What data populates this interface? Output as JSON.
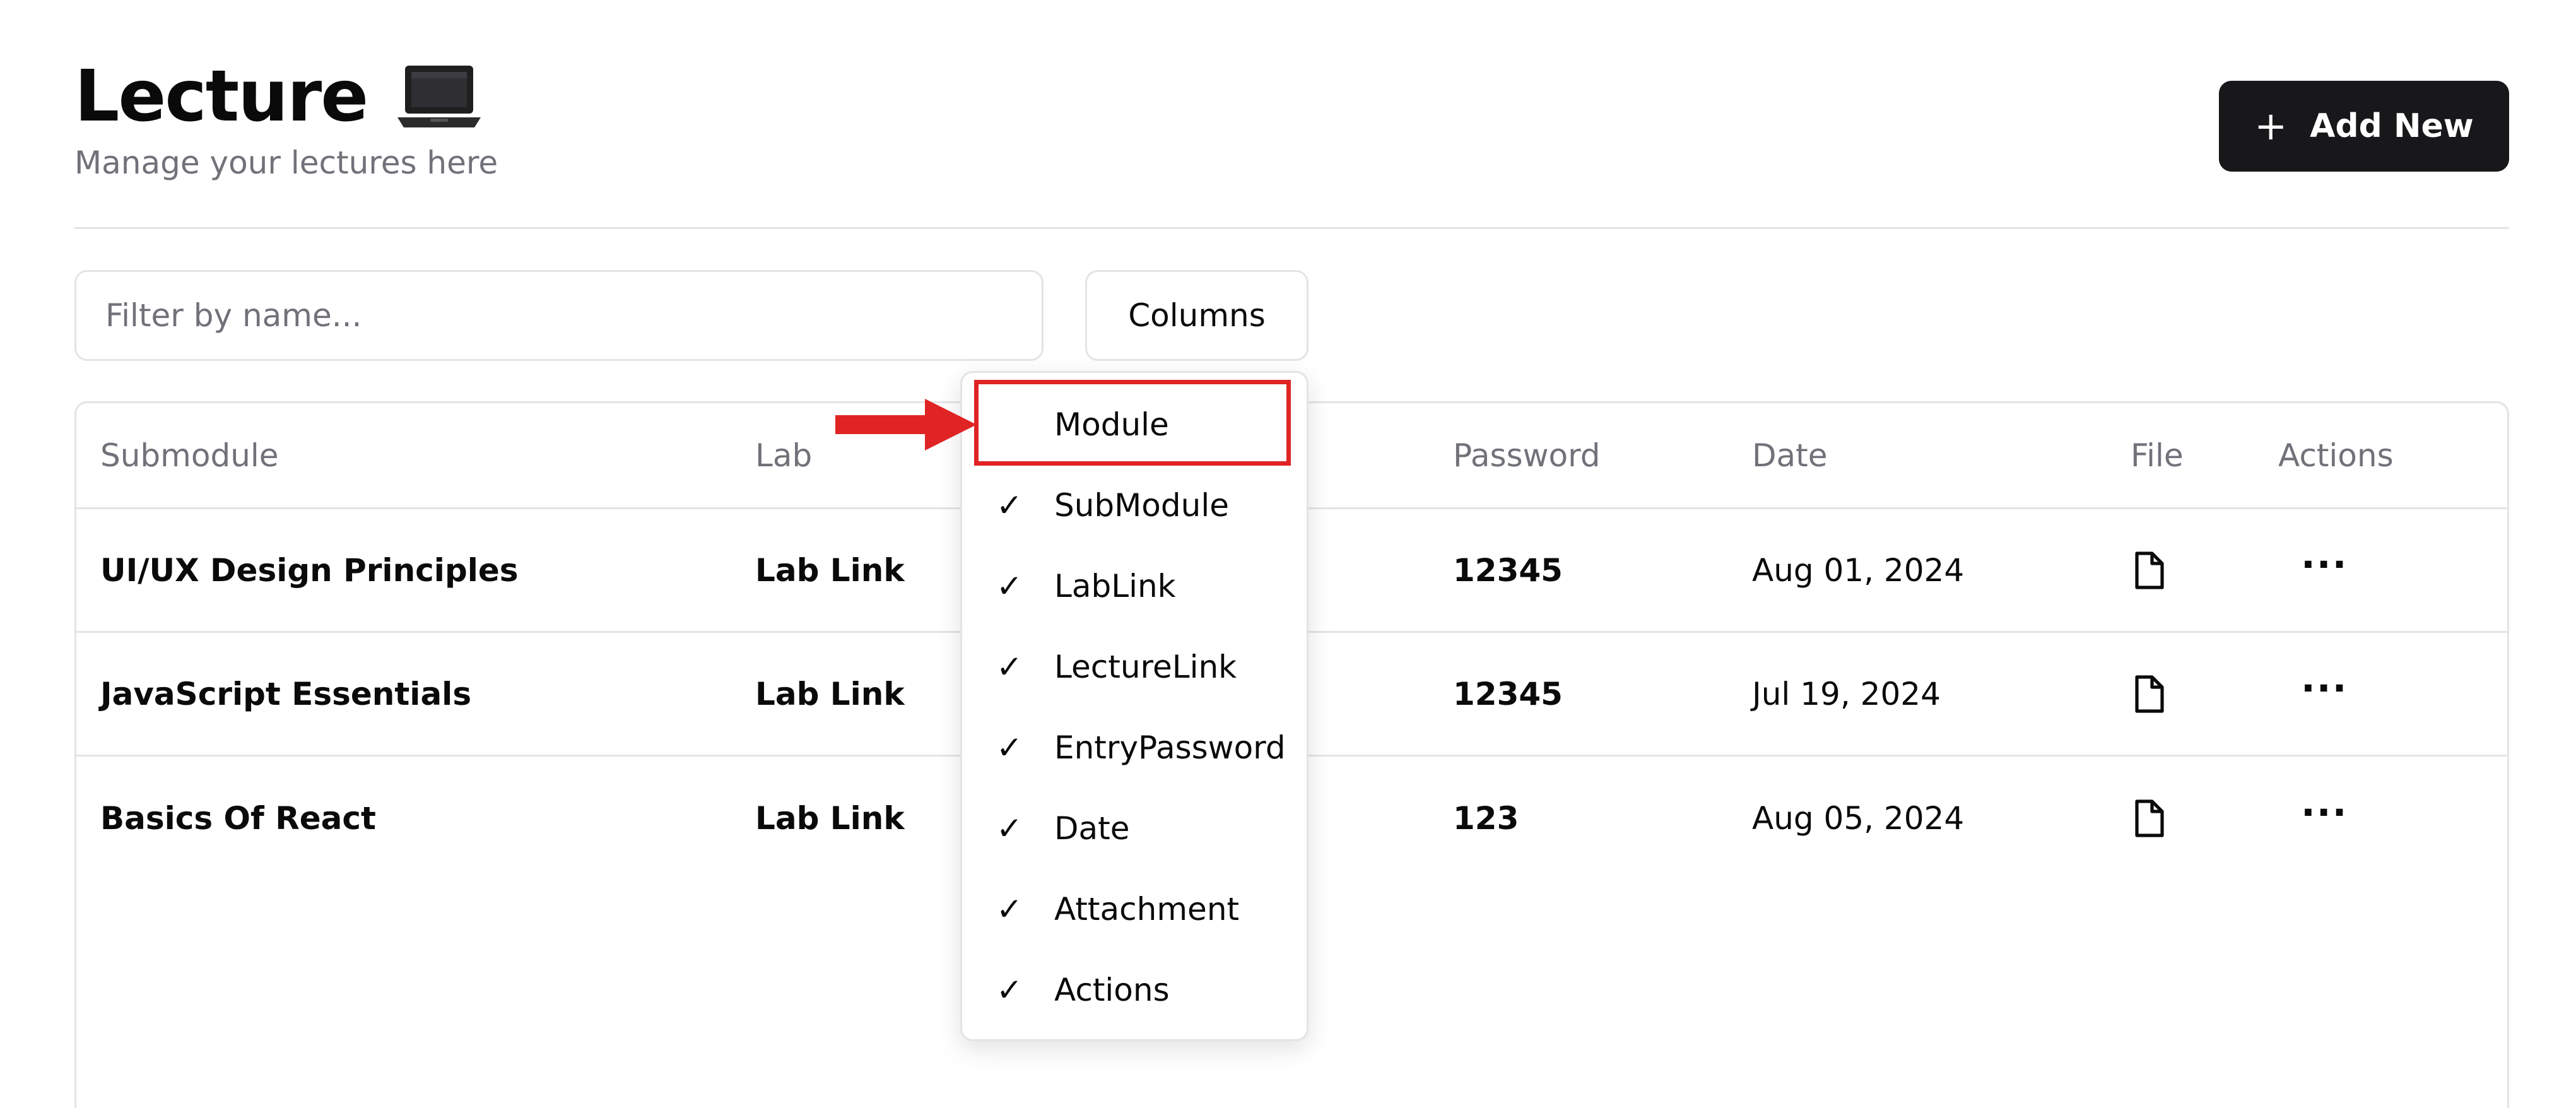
{
  "header": {
    "title": "Lecture",
    "subtitle": "Manage your lectures here",
    "add_button_label": "Add New",
    "add_button_icon": "plus-icon",
    "title_icon": "laptop-icon"
  },
  "toolbar": {
    "filter_placeholder": "Filter by name...",
    "filter_value": "",
    "columns_button_label": "Columns"
  },
  "table": {
    "columns": [
      "Submodule",
      "Lab",
      "Password",
      "Date",
      "File",
      "Actions"
    ],
    "rows": [
      {
        "submodule": "UI/UX Design Principles",
        "lab": "Lab Link",
        "password": "12345",
        "date": "Aug 01, 2024",
        "file_icon": "file-icon",
        "actions": "more-icon"
      },
      {
        "submodule": "JavaScript Essentials",
        "lab": "Lab Link",
        "password": "12345",
        "date": "Jul 19, 2024",
        "file_icon": "file-icon",
        "actions": "more-icon"
      },
      {
        "submodule": "Basics Of React",
        "lab": "Lab Link",
        "password": "123",
        "date": "Aug 05, 2024",
        "file_icon": "file-icon",
        "actions": "more-icon"
      }
    ]
  },
  "columns_menu": {
    "items": [
      {
        "label": "Module",
        "checked": false,
        "highlighted": true
      },
      {
        "label": "SubModule",
        "checked": true
      },
      {
        "label": "LabLink",
        "checked": true
      },
      {
        "label": "LectureLink",
        "checked": true
      },
      {
        "label": "EntryPassword",
        "checked": true
      },
      {
        "label": "Date",
        "checked": true
      },
      {
        "label": "Attachment",
        "checked": true
      },
      {
        "label": "Actions",
        "checked": true
      }
    ]
  },
  "colors": {
    "primary_button": "#18181b",
    "border": "#e4e4e7",
    "muted_text": "#71717a",
    "annotation_red": "#e02424"
  }
}
